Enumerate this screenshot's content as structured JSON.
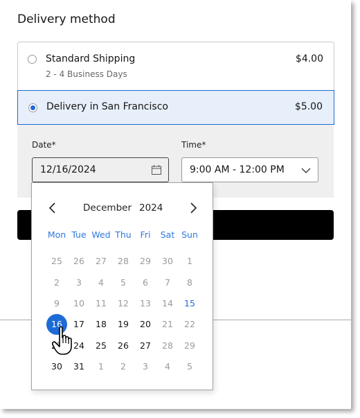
{
  "section": {
    "title": "Delivery method"
  },
  "options": [
    {
      "label": "Standard Shipping",
      "sublabel": "2 - 4 Business Days",
      "price": "$4.00",
      "selected": false
    },
    {
      "label": "Delivery in San Francisco",
      "sublabel": "",
      "price": "$5.00",
      "selected": true
    }
  ],
  "date_field": {
    "label": "Date*",
    "value": "12/16/2024",
    "icon": "calendar-icon"
  },
  "time_field": {
    "label": "Time*",
    "value": "9:00 AM - 12:00 PM",
    "icon": "chevron-down-icon"
  },
  "calendar": {
    "month": "December",
    "year": "2024",
    "prev_icon": "chevron-left-icon",
    "next_icon": "chevron-right-icon",
    "weekdays": [
      "Mon",
      "Tue",
      "Wed",
      "Thu",
      "Fri",
      "Sat",
      "Sun"
    ],
    "weeks": [
      [
        {
          "d": "25",
          "s": "muted"
        },
        {
          "d": "26",
          "s": "muted"
        },
        {
          "d": "27",
          "s": "muted"
        },
        {
          "d": "28",
          "s": "muted"
        },
        {
          "d": "29",
          "s": "muted"
        },
        {
          "d": "30",
          "s": "muted"
        },
        {
          "d": "1",
          "s": "muted"
        }
      ],
      [
        {
          "d": "2",
          "s": "muted"
        },
        {
          "d": "3",
          "s": "muted"
        },
        {
          "d": "4",
          "s": "muted"
        },
        {
          "d": "5",
          "s": "muted"
        },
        {
          "d": "6",
          "s": "muted"
        },
        {
          "d": "7",
          "s": "muted"
        },
        {
          "d": "8",
          "s": "muted"
        }
      ],
      [
        {
          "d": "9",
          "s": "muted"
        },
        {
          "d": "10",
          "s": "muted"
        },
        {
          "d": "11",
          "s": "muted"
        },
        {
          "d": "12",
          "s": "muted"
        },
        {
          "d": "13",
          "s": "muted"
        },
        {
          "d": "14",
          "s": "muted"
        },
        {
          "d": "15",
          "s": "today"
        }
      ],
      [
        {
          "d": "16",
          "s": "selected"
        },
        {
          "d": "17",
          "s": "avail"
        },
        {
          "d": "18",
          "s": "avail"
        },
        {
          "d": "19",
          "s": "avail"
        },
        {
          "d": "20",
          "s": "avail"
        },
        {
          "d": "21",
          "s": "muted"
        },
        {
          "d": "22",
          "s": "muted"
        }
      ],
      [
        {
          "d": "23",
          "s": "avail"
        },
        {
          "d": "24",
          "s": "avail"
        },
        {
          "d": "25",
          "s": "avail"
        },
        {
          "d": "26",
          "s": "avail"
        },
        {
          "d": "27",
          "s": "avail"
        },
        {
          "d": "28",
          "s": "muted"
        },
        {
          "d": "29",
          "s": "muted"
        }
      ],
      [
        {
          "d": "30",
          "s": "avail"
        },
        {
          "d": "31",
          "s": "avail"
        },
        {
          "d": "1",
          "s": "muted"
        },
        {
          "d": "2",
          "s": "muted"
        },
        {
          "d": "3",
          "s": "muted"
        },
        {
          "d": "4",
          "s": "muted"
        },
        {
          "d": "5",
          "s": "muted"
        }
      ]
    ]
  },
  "colors": {
    "accent": "#1d6bd6",
    "selected_bg": "#e7effa",
    "panel_bg": "#efefef",
    "button_bg": "#000000"
  }
}
